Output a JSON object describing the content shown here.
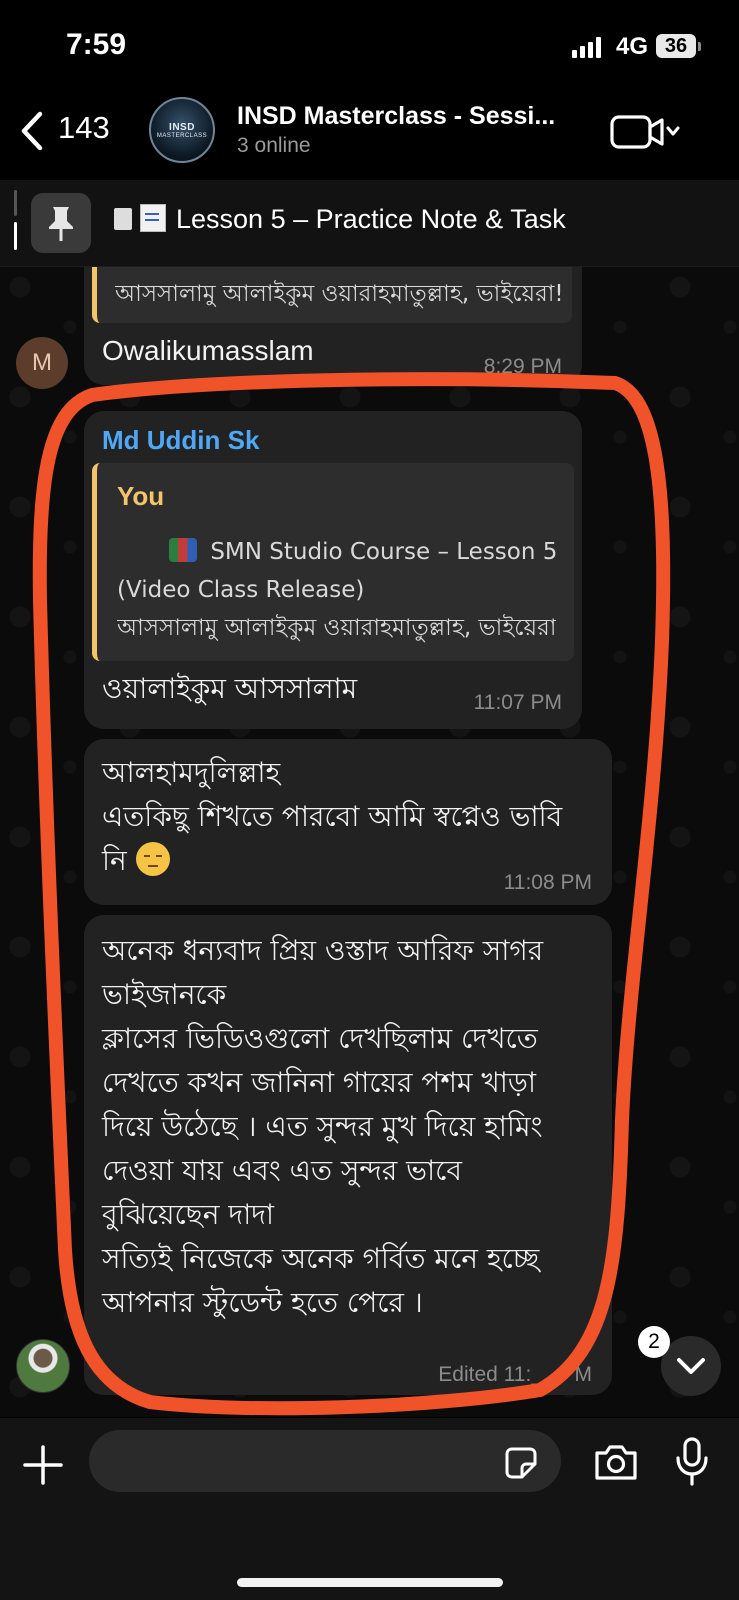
{
  "status_bar": {
    "time": "7:59",
    "network": "4G",
    "battery": "36"
  },
  "header": {
    "back_count": "143",
    "group_name": "INSD Masterclass - Sessi...",
    "online_status": "3 online",
    "avatar_text": "INSD",
    "avatar_subtext": "MASTERCLASS"
  },
  "pinned": {
    "text": "Lesson 5 – Practice Note & Task"
  },
  "messages": {
    "m1": {
      "quote_tail": "আসসালামু আলাইকুম ওয়ারাহমাতুল্লাহ, ভাইয়েরা!",
      "text": "Owalikumasslam",
      "time": "8:29 PM",
      "avatar_letter": "M"
    },
    "m2": {
      "sender": "Md Uddin Sk",
      "quote_name": "You",
      "quote_line1": "SMN Studio Course – Lesson 5",
      "quote_line2": "(Video Class Release)",
      "quote_line3": "আসসালামু আলাইকুম ওয়ারাহমাতুল্লাহ, ভাইয়েরা!",
      "text": "ওয়ালাইকুম আসসালাম",
      "time": "11:07 PM"
    },
    "m3": {
      "line1": "আলহামদুলিল্লাহ",
      "line2": "এতকিছু শিখতে পারবো আমি স্বপ্নেও ভাবি",
      "line3": "নি",
      "time": "11:08 PM"
    },
    "m4": {
      "lines": [
        "অনেক ধন্যবাদ প্রিয় ওস্তাদ আরিফ সাগর",
        "ভাইজানকে",
        "ক্লাসের ভিডিওগুলো দেখছিলাম দেখতে",
        "দেখতে কখন জানিনা গায়ের পশম খাড়া",
        "দিয়ে উঠেছে । এত সুন্দর মুখ দিয়ে হামিং",
        "দেওয়া যায় এবং এত সুন্দর ভাবে",
        "বুঝিয়েছেন দাদা",
        "সত্যিই নিজেকে অনেক গর্বিত মনে হচ্ছে",
        "আপনার স্টুডেন্ট হতে পেরে ।"
      ],
      "footer": "Edited 11:__ PM"
    }
  },
  "scroll_badge": "2",
  "composer": {
    "placeholder": "",
    "value": ""
  },
  "colors": {
    "accent_blue": "#4fa8f5",
    "quote_yellow": "#f2c46b",
    "highlight_red": "#f0522a",
    "bubble": "#222222"
  }
}
